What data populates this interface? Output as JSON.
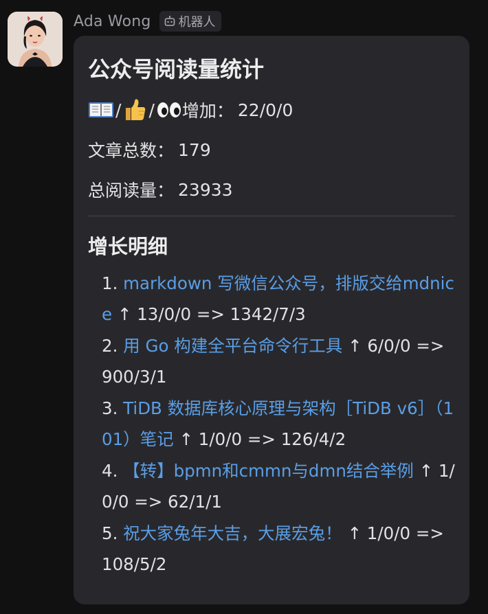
{
  "sender": {
    "name": "Ada Wong",
    "badge_label": "机器人",
    "badge_icon": "robot-icon",
    "avatar_icon": "profile-avatar"
  },
  "message": {
    "title": "公众号阅读量统计",
    "increase": {
      "emoji_icons": [
        "book-icon",
        "thumbs-up-icon",
        "eyes-icon"
      ],
      "label": "增加：",
      "value": "22/0/0"
    },
    "article_count": {
      "label": "文章总数：",
      "value": "179"
    },
    "total_reads": {
      "label": "总阅读量：",
      "value": "23933"
    },
    "growth_title": "增长明细",
    "growth_items": [
      {
        "num": "1.",
        "title": "markdown 写微信公众号，排版交给mdnice",
        "stats": "↑ 13/0/0 => 1342/7/3"
      },
      {
        "num": "2.",
        "title": "用 Go 构建全平台命令行工具",
        "stats": "↑ 6/0/0 => 900/3/1"
      },
      {
        "num": "3.",
        "title": "TiDB 数据库核心原理与架构［TiDB v6］（101）笔记",
        "stats": "↑ 1/0/0 => 126/4/2"
      },
      {
        "num": "4.",
        "title": "【转】bpmn和cmmn与dmn结合举例",
        "stats": "↑ 1/0/0 => 62/1/1"
      },
      {
        "num": "5.",
        "title": "祝大家兔年大吉，大展宏兔！",
        "stats": "↑ 1/0/0 => 108/5/2"
      }
    ]
  },
  "colors": {
    "background": "#111112",
    "bubble": "#28282c",
    "link": "#5a9ee6",
    "sender_name": "#9b9ba0"
  }
}
